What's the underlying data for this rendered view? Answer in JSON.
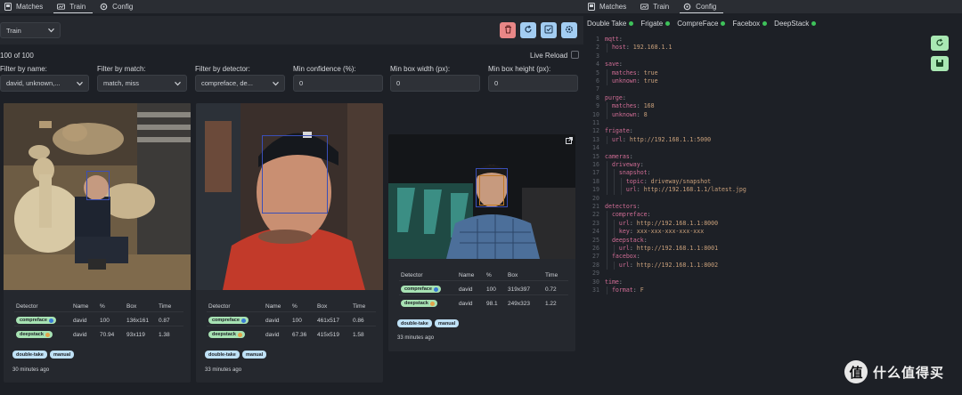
{
  "left_tabs": [
    {
      "label": "Matches",
      "icon": "matches-icon"
    },
    {
      "label": "Train",
      "icon": "train-icon"
    },
    {
      "label": "Config",
      "icon": "gear-icon"
    }
  ],
  "toolbar": {
    "folder_select": "Train",
    "buttons": [
      {
        "name": "delete-button",
        "icon": "trash-icon",
        "color": "#e98787"
      },
      {
        "name": "refresh-button",
        "icon": "refresh-icon",
        "color": "#a3cdf2"
      },
      {
        "name": "select-all-button",
        "icon": "checkbox-icon",
        "color": "#a3cdf2"
      },
      {
        "name": "settings-button",
        "icon": "gear-icon",
        "color": "#a3cdf2"
      }
    ]
  },
  "count_text": "100 of 100",
  "live_reload_label": "Live Reload",
  "filters": [
    {
      "label": "Filter by name:",
      "value": "david, unknown,...",
      "type": "select"
    },
    {
      "label": "Filter by match:",
      "value": "match, miss",
      "type": "select"
    },
    {
      "label": "Filter by detector:",
      "value": "compreface, de...",
      "type": "select"
    },
    {
      "label": "Min confidence (%):",
      "value": "0",
      "type": "input"
    },
    {
      "label": "Min box width (px):",
      "value": "0",
      "type": "input"
    },
    {
      "label": "Min box height (px):",
      "value": "0",
      "type": "input"
    }
  ],
  "table_headers": [
    "Detector",
    "Name",
    "%",
    "Box",
    "Time"
  ],
  "cards": [
    {
      "rows": [
        {
          "detector": "compreface",
          "dot": "#3a7bd5",
          "name": "david",
          "pct": "100",
          "box": "136x161",
          "time": "0.87"
        },
        {
          "detector": "deepstack",
          "dot": "#e2a34a",
          "name": "david",
          "pct": "70.94",
          "box": "93x119",
          "time": "1.38"
        }
      ],
      "tags": [
        "double-take",
        "manual"
      ],
      "ago": "30 minutes ago"
    },
    {
      "rows": [
        {
          "detector": "compreface",
          "dot": "#3a7bd5",
          "name": "david",
          "pct": "100",
          "box": "461x517",
          "time": "0.86"
        },
        {
          "detector": "deepstack",
          "dot": "#e2a34a",
          "name": "david",
          "pct": "67.36",
          "box": "415x519",
          "time": "1.58"
        }
      ],
      "tags": [
        "double-take",
        "manual"
      ],
      "ago": "33 minutes ago"
    },
    {
      "rows": [
        {
          "detector": "compreface",
          "dot": "#3a7bd5",
          "name": "david",
          "pct": "100",
          "box": "319x397",
          "time": "0.72"
        },
        {
          "detector": "deepstack",
          "dot": "#e2a34a",
          "name": "david",
          "pct": "98.1",
          "box": "249x323",
          "time": "1.22"
        }
      ],
      "tags": [
        "double-take",
        "manual"
      ],
      "ago": "33 minutes ago"
    }
  ],
  "right_tabs": [
    {
      "label": "Matches",
      "icon": "matches-icon"
    },
    {
      "label": "Train",
      "icon": "train-icon"
    },
    {
      "label": "Config",
      "icon": "gear-icon"
    }
  ],
  "services": [
    {
      "label": "Double Take",
      "status": "#3ec25a"
    },
    {
      "label": "Frigate",
      "status": "#3ec25a"
    },
    {
      "label": "CompreFace",
      "status": "#3ec25a"
    },
    {
      "label": "Facebox",
      "status": "#3ec25a"
    },
    {
      "label": "DeepStack",
      "status": "#3ec25a"
    }
  ],
  "config_lines": [
    "mqtt:",
    "  host: 192.168.1.1",
    "",
    "save:",
    "  matches: true",
    "  unknown: true",
    "",
    "purge:",
    "  matches: 168",
    "  unknown: 8",
    "",
    "frigate:",
    "  url: http://192.168.1.1:5000",
    "",
    "cameras:",
    "  driveway:",
    "    snapshot:",
    "      topic: driveway/snapshot",
    "      url: http://192.168.1.1/latest.jpg",
    "",
    "detectors:",
    "  compreface:",
    "    url: http://192.168.1.1:8000",
    "    key: xxx-xxx-xxx-xxx-xxx",
    "  deepstack:",
    "    url: http://192.168.1.1:8001",
    "  facebox:",
    "    url: http://192.168.1.1:8002",
    "",
    "time:",
    "  format: F"
  ],
  "editor_buttons": [
    {
      "name": "config-refresh-button",
      "icon": "refresh-icon"
    },
    {
      "name": "config-save-button",
      "icon": "save-icon"
    }
  ],
  "watermark": {
    "glyph": "值",
    "text": "什么值得买"
  }
}
